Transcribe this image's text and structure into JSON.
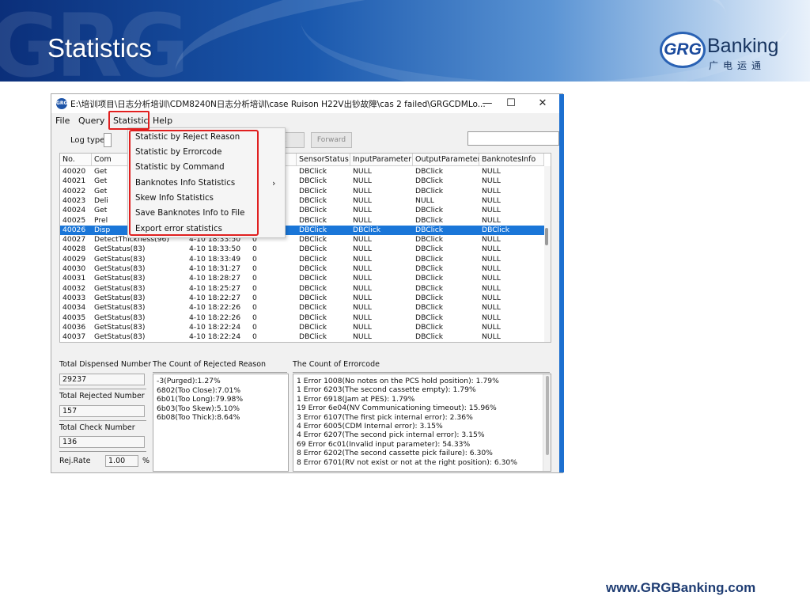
{
  "slide": {
    "title": "Statistics",
    "logo_badge": "GRG",
    "logo_word": "Banking",
    "logo_cn": "广电运通",
    "footer_url": "www.GRGBanking.com"
  },
  "window": {
    "title": "E:\\培训项目\\日志分析培训\\CDM8240N日志分析培训\\case Ruison H22V出钞故障\\cas 2 failed\\GRGCDMLo...",
    "minimize": "—",
    "maximize": "☐",
    "close": "✕",
    "menus": [
      "File",
      "Query",
      "Statistic",
      "Help"
    ],
    "toolbar": {
      "log_type_label": "Log type",
      "back_label": "k",
      "forward_label": "Forward"
    }
  },
  "dropdown": {
    "items": [
      "Statistic by Reject Reason",
      "Statistic by Errorcode",
      "Statistic by Command",
      "Banknotes Info Statistics",
      "Skew Info Statistics",
      "Save Banknotes Info to File",
      "Export error statistics"
    ],
    "submenu_arrow": "›"
  },
  "grid": {
    "headers": [
      "No.",
      "Com",
      "",
      "",
      "SensorStatus",
      "InputParameter",
      "OutputParameter",
      "BanknotesInfo"
    ],
    "rows": [
      {
        "no": "40020",
        "cmd": "Get",
        "time": "",
        "code": "",
        "sensor": "DBClick",
        "input": "NULL",
        "output": "DBClick",
        "bank": "NULL"
      },
      {
        "no": "40021",
        "cmd": "Get",
        "time": "",
        "code": "",
        "sensor": "DBClick",
        "input": "NULL",
        "output": "DBClick",
        "bank": "NULL"
      },
      {
        "no": "40022",
        "cmd": "Get",
        "time": "",
        "code": "",
        "sensor": "DBClick",
        "input": "NULL",
        "output": "DBClick",
        "bank": "NULL"
      },
      {
        "no": "40023",
        "cmd": "Deli",
        "time": "",
        "code": "",
        "sensor": "DBClick",
        "input": "NULL",
        "output": "NULL",
        "bank": "NULL"
      },
      {
        "no": "40024",
        "cmd": "Get",
        "time": "",
        "code": "",
        "sensor": "DBClick",
        "input": "NULL",
        "output": "DBClick",
        "bank": "NULL"
      },
      {
        "no": "40025",
        "cmd": "Prel",
        "time": "",
        "code": "",
        "sensor": "DBClick",
        "input": "NULL",
        "output": "DBClick",
        "bank": "NULL"
      },
      {
        "no": "40026",
        "cmd": "Disp",
        "time": "",
        "code": "",
        "sensor": "DBClick",
        "input": "DBClick",
        "output": "DBClick",
        "bank": "DBClick"
      },
      {
        "no": "40027",
        "cmd": "DetectThickness(96)",
        "time": "4-10 18:33:50",
        "code": "0",
        "sensor": "DBClick",
        "input": "NULL",
        "output": "DBClick",
        "bank": "NULL"
      },
      {
        "no": "40028",
        "cmd": "GetStatus(83)",
        "time": "4-10 18:33:50",
        "code": "0",
        "sensor": "DBClick",
        "input": "NULL",
        "output": "DBClick",
        "bank": "NULL"
      },
      {
        "no": "40029",
        "cmd": "GetStatus(83)",
        "time": "4-10 18:33:49",
        "code": "0",
        "sensor": "DBClick",
        "input": "NULL",
        "output": "DBClick",
        "bank": "NULL"
      },
      {
        "no": "40030",
        "cmd": "GetStatus(83)",
        "time": "4-10 18:31:27",
        "code": "0",
        "sensor": "DBClick",
        "input": "NULL",
        "output": "DBClick",
        "bank": "NULL"
      },
      {
        "no": "40031",
        "cmd": "GetStatus(83)",
        "time": "4-10 18:28:27",
        "code": "0",
        "sensor": "DBClick",
        "input": "NULL",
        "output": "DBClick",
        "bank": "NULL"
      },
      {
        "no": "40032",
        "cmd": "GetStatus(83)",
        "time": "4-10 18:25:27",
        "code": "0",
        "sensor": "DBClick",
        "input": "NULL",
        "output": "DBClick",
        "bank": "NULL"
      },
      {
        "no": "40033",
        "cmd": "GetStatus(83)",
        "time": "4-10 18:22:27",
        "code": "0",
        "sensor": "DBClick",
        "input": "NULL",
        "output": "DBClick",
        "bank": "NULL"
      },
      {
        "no": "40034",
        "cmd": "GetStatus(83)",
        "time": "4-10 18:22:26",
        "code": "0",
        "sensor": "DBClick",
        "input": "NULL",
        "output": "DBClick",
        "bank": "NULL"
      },
      {
        "no": "40035",
        "cmd": "GetStatus(83)",
        "time": "4-10 18:22:26",
        "code": "0",
        "sensor": "DBClick",
        "input": "NULL",
        "output": "DBClick",
        "bank": "NULL"
      },
      {
        "no": "40036",
        "cmd": "GetStatus(83)",
        "time": "4-10 18:22:24",
        "code": "0",
        "sensor": "DBClick",
        "input": "NULL",
        "output": "DBClick",
        "bank": "NULL"
      },
      {
        "no": "40037",
        "cmd": "GetStatus(83)",
        "time": "4-10 18:22:24",
        "code": "0",
        "sensor": "DBClick",
        "input": "NULL",
        "output": "DBClick",
        "bank": "NULL"
      }
    ]
  },
  "summary": {
    "total_dispensed_label": "Total Dispensed Number",
    "total_dispensed_value": "29237",
    "total_rejected_label": "Total Rejected Number",
    "total_rejected_value": "157",
    "total_check_label": "Total Check Number",
    "total_check_value": "136",
    "rej_rate_label": "Rej.Rate",
    "rej_rate_value": "1.00",
    "rej_rate_unit": "%"
  },
  "rejected_panel": {
    "label": "The Count of Rejected Reason",
    "lines": [
      "-3(Purged):1.27%",
      "6802(Too Close):7.01%",
      "6b01(Too Long):79.98%",
      "6b03(Too Skew):5.10%",
      "6b08(Too Thick):8.64%"
    ]
  },
  "errorcode_panel": {
    "label": "The Count of Errorcode",
    "lines": [
      "1 Error 1008(No notes on the PCS hold position): 1.79%",
      "1 Error 6203(The second cassette empty): 1.79%",
      "1 Error 6918(Jam at PES): 1.79%",
      "19 Error 6e04(NV Communicationing timeout): 15.96%",
      "3 Error 6107(The first pick internal error): 2.36%",
      "4 Error 6005(CDM Internal error): 3.15%",
      "4 Error 6207(The second pick internal error): 3.15%",
      "69 Error 6c01(Invalid input parameter): 54.33%",
      "8 Error 6202(The second cassette pick failure): 6.30%",
      "8 Error 6701(RV not exist or not at the right position): 6.30%"
    ]
  },
  "colors": {
    "selection": "#1a76d8",
    "highlight_box": "#e02020",
    "banner_dark": "#0b2f7a"
  }
}
